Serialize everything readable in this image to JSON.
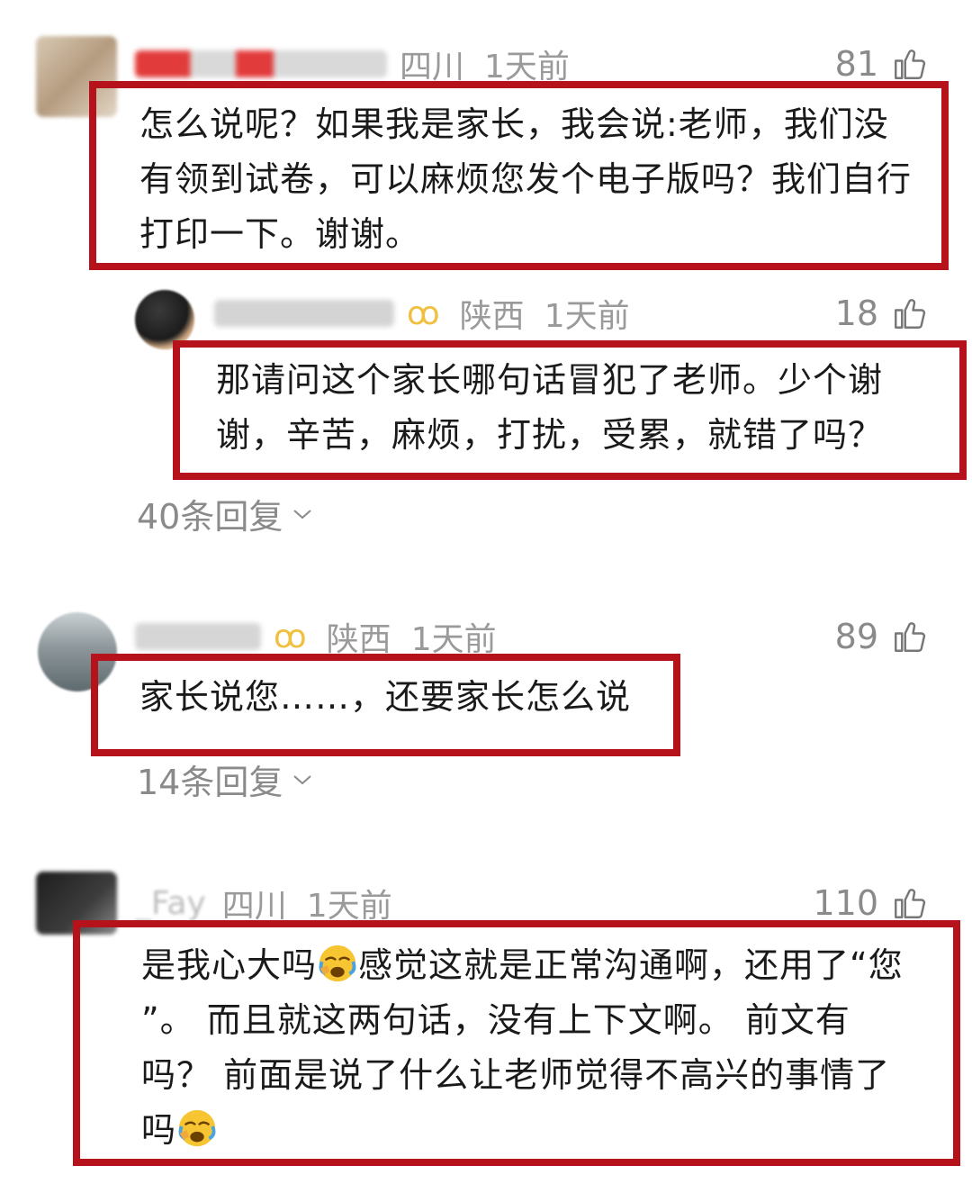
{
  "comments": [
    {
      "location": "四川",
      "time": "1天前",
      "likes": "81",
      "lines": [
        "怎么说呢？如果我是家长，我会说:老师，我们没",
        "有领到试卷，可以麻烦您发个电子版吗？我们自行",
        "打印一下。谢谢。"
      ],
      "reply": {
        "location": "陕西",
        "time": "1天前",
        "likes": "18",
        "lines": [
          "那请问这个家长哪句话冒犯了老师。少个谢",
          "谢，辛苦，麻烦，打扰，受累，就错了吗？"
        ]
      },
      "replies_label": "40条回复"
    },
    {
      "location": "陕西",
      "time": "1天前",
      "likes": "89",
      "lines": [
        "家长说您……，还要家长怎么说"
      ],
      "replies_label": "14条回复"
    },
    {
      "username": "_Fay",
      "location": "四川",
      "time": "1天前",
      "likes": "110",
      "line1_a": "是我心大吗",
      "line1_b": "感觉这就是正常沟通啊，还用了“您",
      "line2": "”。 而且就这两句话，没有上下文啊。 前文有",
      "line3": "吗？ 前面是说了什么让老师觉得不高兴的事情了",
      "line4": "吗"
    }
  ],
  "colors": {
    "highlight_border": "#b5121b",
    "meta_gray": "#9a9a9a"
  },
  "icons": {
    "like": "thumbs-up-icon",
    "expand": "chevron-down-icon",
    "emoji": "crying-face-emoji-icon"
  }
}
